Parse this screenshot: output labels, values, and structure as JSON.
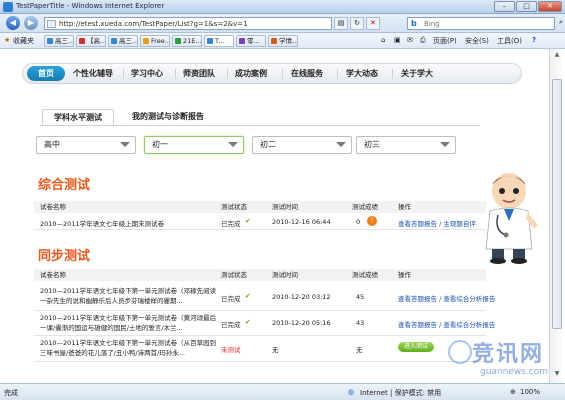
{
  "window": {
    "title": "TestPaperTitle - Windows Internet Explorer",
    "min": "–",
    "max": "□",
    "close": "✕"
  },
  "address": {
    "url": "http://etest.xueda.com/TestPaper/List?g=1&s=2&v=1",
    "refresh": "↻",
    "stop": "✕",
    "search_placeholder": "Bing",
    "search_brand": "b",
    "compat": "▤"
  },
  "favorites": {
    "label": "收藏夹",
    "tabs": [
      "高三...",
      "【高...",
      "高三...",
      "Free...",
      "21E...",
      "T...",
      "零...",
      "学情..."
    ],
    "tools": [
      "页面(P)",
      "安全(S)",
      "工具(O)",
      "?"
    ]
  },
  "nav": {
    "items": [
      "首页",
      "个性化辅导",
      "学习中心",
      "师资团队",
      "成功案例",
      "在线服务",
      "学大动态",
      "关于学大"
    ]
  },
  "subtabs": [
    "学科水平测试",
    "我的测试与诊断报告"
  ],
  "selects": [
    "高中",
    "初一",
    "初二",
    "初三"
  ],
  "sections": {
    "comprehensive": {
      "title": "综合测试",
      "headers": [
        "试卷名称",
        "测试状态",
        "测试时间",
        "测试成绩",
        "操作"
      ],
      "rows": [
        {
          "name": "2010—2011学年语文七年级上期末测试卷",
          "status": "已完成",
          "time": "2010-12-16 06:44",
          "score": "0",
          "action": "查看答题报告 / 主观题自评"
        }
      ]
    },
    "sync": {
      "title": "同步测试",
      "headers": [
        "试卷名称",
        "测试状态",
        "测试时间",
        "测试成绩",
        "操作"
      ],
      "rows": [
        {
          "name": "2010—2011学年语文七年级下第一单元测试卷（邓稼先阅读一杂先生的说和幽静乐后人员步芬瑞楼样的瞿期...",
          "status": "已完成",
          "time": "2010-12-20 03:12",
          "score": "45",
          "action": "查看答题报告 / 查看综合分析报告"
        },
        {
          "name": "2010—2011学年语文七年级下第一单元测试卷（黄河颂最后一课/囊渐的国运与雄健的国民/土地的誓言/木兰...",
          "status": "已完成",
          "time": "2010-12-20 05:16",
          "score": "43",
          "action": "查看答题报告 / 查看综合分析报告"
        },
        {
          "name": "2010—2011学年语文七年级下第一单元测试卷（从百草园到三味书屋/爸爸的花儿落了/丑小鸭/诗两首/玛孙永...",
          "status": "未测试",
          "time": "无",
          "score": "无",
          "action": "进入测试"
        }
      ]
    }
  },
  "status": {
    "left": "完成",
    "zone": "Internet | 保护模式: 禁用",
    "zoom": "100%"
  },
  "watermark": {
    "name": "竞讯网",
    "url": "guannews.com"
  }
}
